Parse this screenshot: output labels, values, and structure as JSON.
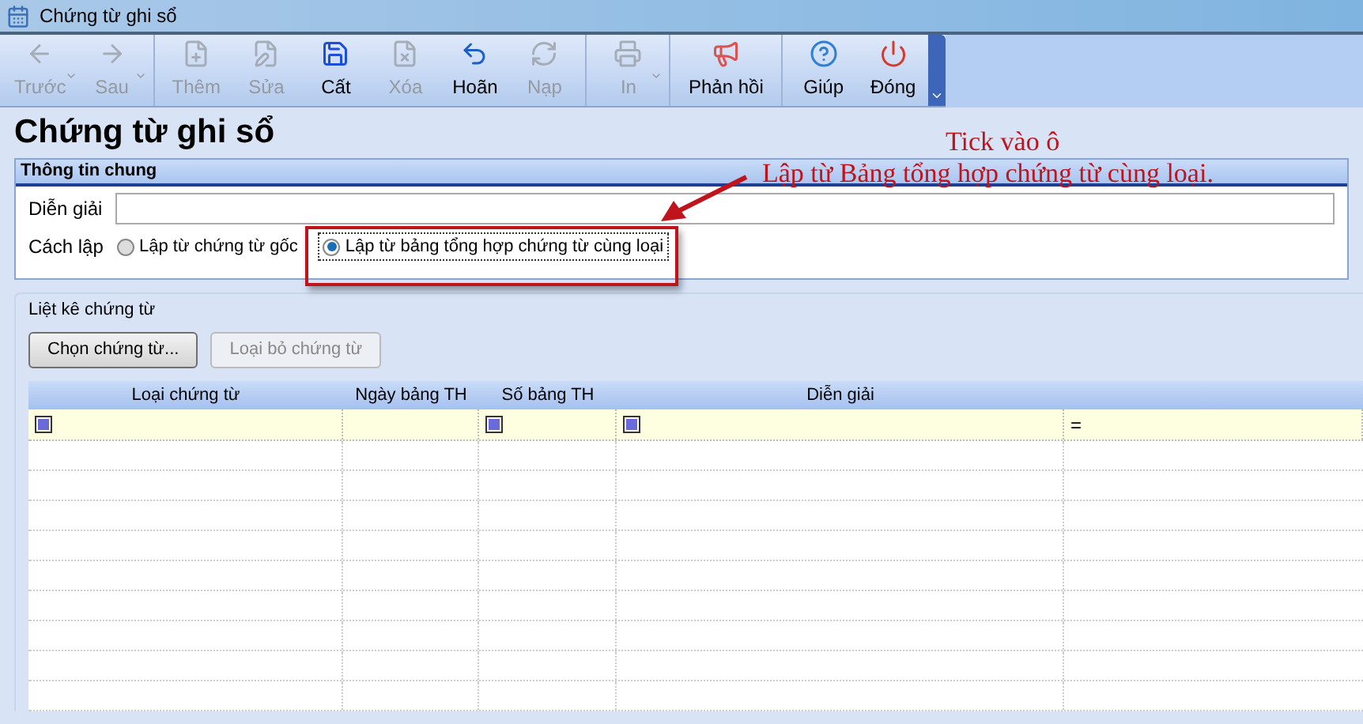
{
  "window": {
    "title": "Chứng từ ghi sổ"
  },
  "toolbar": [
    [
      {
        "label": "Trước",
        "disabled": true,
        "dropdown": true
      },
      {
        "label": "Sau",
        "disabled": true,
        "dropdown": true
      }
    ],
    [
      {
        "label": "Thêm",
        "disabled": true,
        "dropdown": false
      },
      {
        "label": "Sửa",
        "disabled": true,
        "dropdown": false
      },
      {
        "label": "Cất",
        "disabled": false,
        "dropdown": false
      },
      {
        "label": "Xóa",
        "disabled": true,
        "dropdown": false
      },
      {
        "label": "Hoãn",
        "disabled": false,
        "dropdown": false
      },
      {
        "label": "Nạp",
        "disabled": true,
        "dropdown": false
      }
    ],
    [
      {
        "label": "In",
        "disabled": true,
        "dropdown": true
      }
    ],
    [
      {
        "label": "Phản hồi",
        "disabled": false,
        "dropdown": false
      }
    ],
    [
      {
        "label": "Giúp",
        "disabled": false,
        "dropdown": false
      },
      {
        "label": "Đóng",
        "disabled": false,
        "dropdown": false
      }
    ]
  ],
  "heading": "Chứng từ ghi sổ",
  "general": {
    "title": "Thông tin chung",
    "description_label": "Diễn giải",
    "method_label": "Cách lập",
    "options": [
      {
        "label": "Lập từ chứng từ gốc",
        "selected": false
      },
      {
        "label": "Lập từ bảng tổng hợp chứng từ cùng loại",
        "selected": true
      }
    ]
  },
  "list": {
    "title": "Liệt kê chứng từ",
    "buttons": [
      {
        "label": "Chọn chứng từ...",
        "disabled": false
      },
      {
        "label": "Loại bỏ chứng từ",
        "disabled": true
      }
    ],
    "columns": [
      "Loại chứng từ",
      "Ngày bảng TH",
      "Số bảng TH",
      "Diễn giải"
    ],
    "filter_row": [
      {
        "kind": "box"
      },
      {
        "kind": "empty"
      },
      {
        "kind": "box"
      },
      {
        "kind": "box"
      },
      {
        "kind": "text",
        "text": "="
      }
    ]
  },
  "annotation": {
    "lines": [
      "Tick vào ô",
      "Lập từ Bảng tổng hợp chứng từ cùng loại."
    ]
  }
}
